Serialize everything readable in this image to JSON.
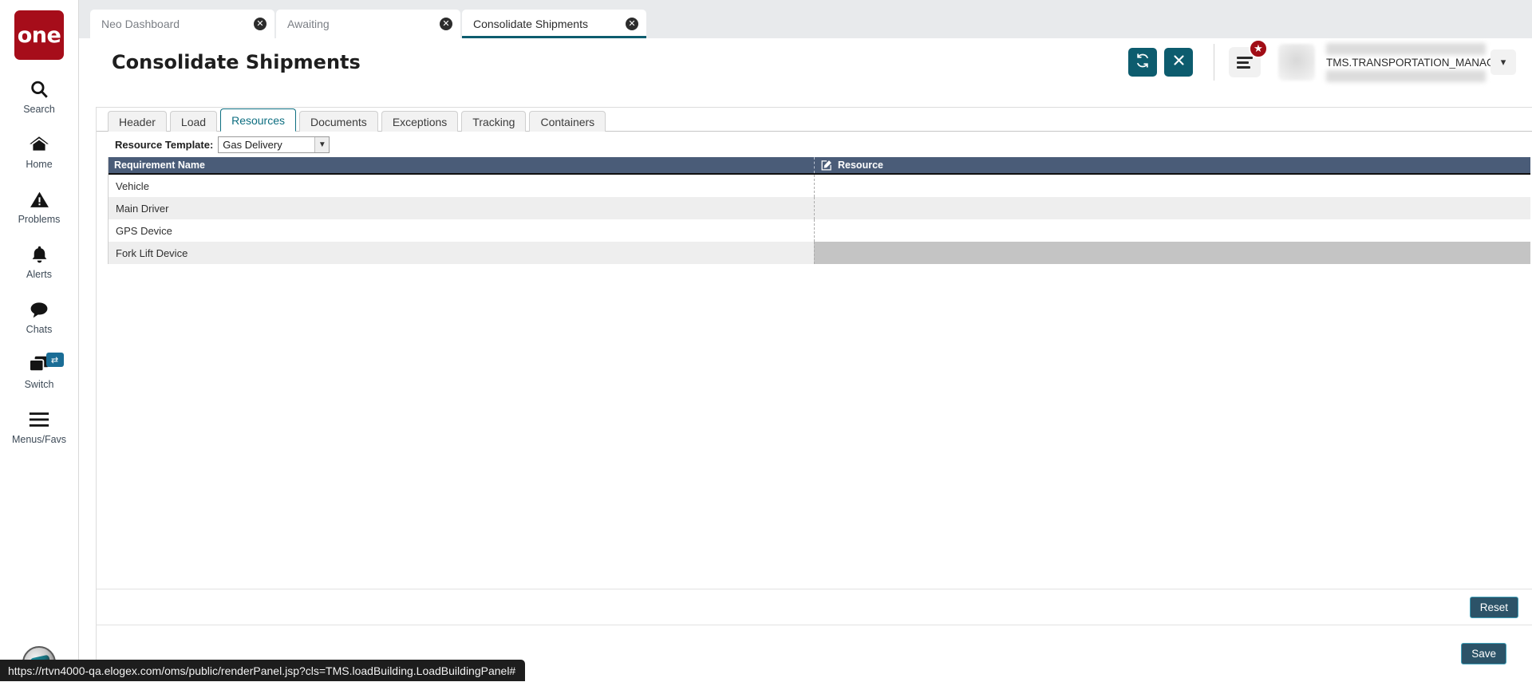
{
  "colors": {
    "brand_red": "#a60d1a",
    "teal": "#0d5c6e",
    "grid_header_blue": "#4a5c78",
    "button_dark": "#2c5368",
    "button_border": "#3e9fb8",
    "selected_cell": "#c4c4c4"
  },
  "rail": {
    "logo_text": "one",
    "items": [
      {
        "label": "Search",
        "icon": "search-icon"
      },
      {
        "label": "Home",
        "icon": "home-icon"
      },
      {
        "label": "Problems",
        "icon": "warning-triangle-icon"
      },
      {
        "label": "Alerts",
        "icon": "bell-icon"
      },
      {
        "label": "Chats",
        "icon": "chat-bubble-icon"
      },
      {
        "label": "Switch",
        "icon": "windows-stack-icon",
        "badge_icon": "swap-arrows-icon"
      },
      {
        "label": "Menus/Favs",
        "icon": "hamburger-icon"
      }
    ]
  },
  "browser_tabs": [
    {
      "label": "Neo Dashboard",
      "active": false,
      "close_icon": "close-circle-icon"
    },
    {
      "label": "Awaiting",
      "active": false,
      "close_icon": "close-circle-icon"
    },
    {
      "label": "Consolidate Shipments",
      "active": true,
      "close_icon": "close-circle-icon"
    }
  ],
  "header": {
    "title": "Consolidate Shipments",
    "refresh_icon": "refresh-icon",
    "close_icon": "close-x-icon",
    "menu_icon": "hamburger-menu-icon",
    "favorite_badge_icon": "star-icon",
    "avatar": "user-avatar",
    "user_role": "TMS.TRANSPORTATION_MANAGER",
    "caret_icon": "chevron-down-icon"
  },
  "inner_tabs": [
    {
      "label": "Header",
      "active": false
    },
    {
      "label": "Load",
      "active": false
    },
    {
      "label": "Resources",
      "active": true
    },
    {
      "label": "Documents",
      "active": false
    },
    {
      "label": "Exceptions",
      "active": false
    },
    {
      "label": "Tracking",
      "active": false
    },
    {
      "label": "Containers",
      "active": false
    }
  ],
  "form": {
    "template_label": "Resource Template:",
    "template_value": "Gas Delivery",
    "template_caret_icon": "chevron-down-icon"
  },
  "grid": {
    "edit_icon": "edit-pencil-icon",
    "columns": [
      {
        "key": "requirement_name",
        "label": "Requirement Name"
      },
      {
        "key": "resource",
        "label": "Resource"
      }
    ],
    "rows": [
      {
        "requirement_name": "Vehicle",
        "resource": "",
        "selected": false
      },
      {
        "requirement_name": "Main Driver",
        "resource": "",
        "selected": false
      },
      {
        "requirement_name": "GPS Device",
        "resource": "",
        "selected": false
      },
      {
        "requirement_name": "Fork Lift Device",
        "resource": "",
        "selected": true
      }
    ]
  },
  "footer": {
    "reset_label": "Reset",
    "save_label": "Save"
  },
  "statusbar": {
    "url": "https://rtvn4000-qa.elogex.com/oms/public/renderPanel.jsp?cls=TMS.loadBuilding.LoadBuildingPanel#"
  }
}
